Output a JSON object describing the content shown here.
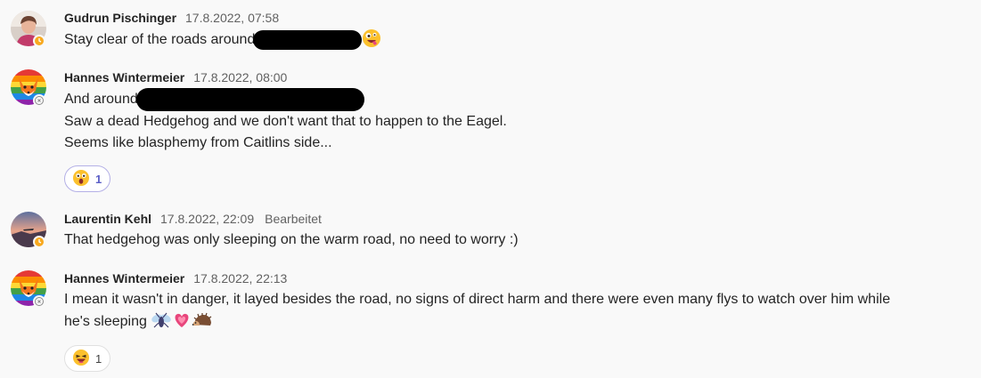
{
  "messages": [
    {
      "author": "Gudrun Pischinger",
      "time": "17.8.2022, 07:58",
      "presence": "away",
      "lines": [
        "Stay clear of the roads around"
      ],
      "emoji_after": "zany-face"
    },
    {
      "author": "Hannes Wintermeier",
      "time": "17.8.2022, 08:00",
      "presence": "offline",
      "lines": [
        "And around",
        "Saw a dead Hedgehog and we don't want that to happen to the Eagel.",
        "Seems like blasphemy from Caitlins side..."
      ],
      "reaction": {
        "emoji": "surprised-face",
        "count": "1"
      }
    },
    {
      "author": "Laurentin Kehl",
      "time": "17.8.2022, 22:09",
      "edited": "Bearbeitet",
      "presence": "away",
      "lines": [
        "That hedgehog was only sleeping on the warm road, no need to worry :)"
      ]
    },
    {
      "author": "Hannes Wintermeier",
      "time": "17.8.2022, 22:13",
      "presence": "offline",
      "lines": [
        "I mean it wasn't in danger, it layed besides the road, no signs of direct harm and there were even many flys to watch over him while",
        "he's sleeping"
      ],
      "emoji_after": [
        "fly",
        "growing-heart",
        "hedgehog"
      ],
      "reaction": {
        "emoji": "laughing-face",
        "count": "1"
      }
    }
  ],
  "colors": {
    "background": "#f9f9f9",
    "text": "#242424",
    "meta": "#616161",
    "reaction_accent": "#5b5fc7",
    "away": "#f8a91f"
  }
}
